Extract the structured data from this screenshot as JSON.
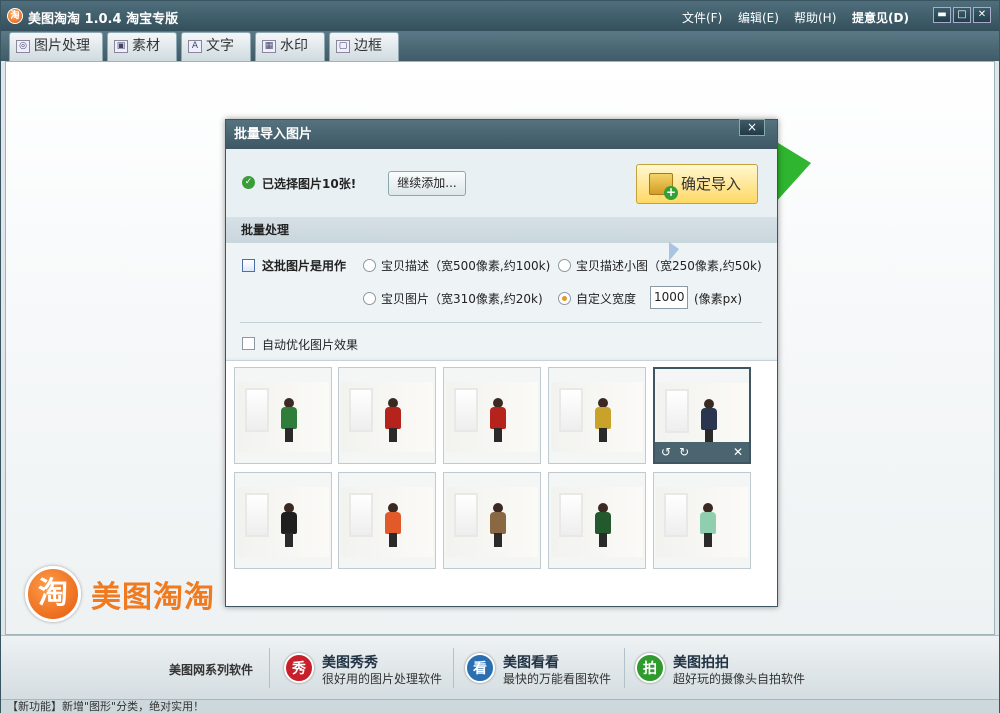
{
  "app": {
    "title": "美图淘淘 1.0.4 淘宝专版",
    "logo_char": "淘"
  },
  "menu": {
    "file": "文件(F)",
    "edit": "编辑(E)",
    "help": "帮助(H)",
    "feedback": "提意见(D)"
  },
  "window_controls": {
    "minimize": "▬",
    "maximize": "□",
    "close": "✕"
  },
  "tabs": [
    {
      "label": "图片处理",
      "icon": "image-process-icon"
    },
    {
      "label": "素材",
      "icon": "material-icon"
    },
    {
      "label": "文字",
      "icon": "text-icon"
    },
    {
      "label": "水印",
      "icon": "watermark-icon"
    },
    {
      "label": "边框",
      "icon": "frame-icon"
    }
  ],
  "brand": {
    "circle_char": "淘",
    "word": "美图淘淘"
  },
  "dialog": {
    "title": "批量导入图片",
    "close": "×",
    "selected_text": "已选择图片10张!",
    "add_more": "继续添加...",
    "confirm": "确定导入",
    "batch_heading": "批量处理",
    "use_label": "这批图片是用作",
    "options": [
      {
        "label": "宝贝描述（宽500像素,约100k)",
        "checked": false
      },
      {
        "label": "宝贝描述小图（宽250像素,约50k)",
        "checked": false
      },
      {
        "label": "宝贝图片（宽310像素,约20k)",
        "checked": false
      },
      {
        "label": "自定义宽度",
        "checked": true
      }
    ],
    "custom_width": "1000",
    "width_unit": "(像素px)",
    "auto_optimize": "自动优化图片效果",
    "thumb_tools": {
      "rotate_left": "↺",
      "rotate_right": "↻",
      "remove": "✕"
    },
    "thumbnails": [
      {
        "outfit": "#2e7d3a"
      },
      {
        "outfit": "#b5231c"
      },
      {
        "outfit": "#b5231c"
      },
      {
        "outfit": "#c9a22a"
      },
      {
        "outfit": "#2a3550"
      },
      {
        "outfit": "#1f1f1f"
      },
      {
        "outfit": "#e35a2a"
      },
      {
        "outfit": "#8a6844"
      },
      {
        "outfit": "#23592d"
      },
      {
        "outfit": "#8fcfb0"
      }
    ]
  },
  "footer": {
    "series": "美图网系列软件",
    "products": [
      {
        "badge": "秀",
        "name": "美图秀秀",
        "desc": "很好用的图片处理软件",
        "color": "#c8202a"
      },
      {
        "badge": "看",
        "name": "美图看看",
        "desc": "最快的万能看图软件",
        "color": "#2b6fb0"
      },
      {
        "badge": "拍",
        "name": "美图拍拍",
        "desc": "超好玩的摄像头自拍软件",
        "color": "#2f9b2f"
      }
    ]
  },
  "status": {
    "text": "【新功能】新增\"图形\"分类，绝对实用！"
  }
}
